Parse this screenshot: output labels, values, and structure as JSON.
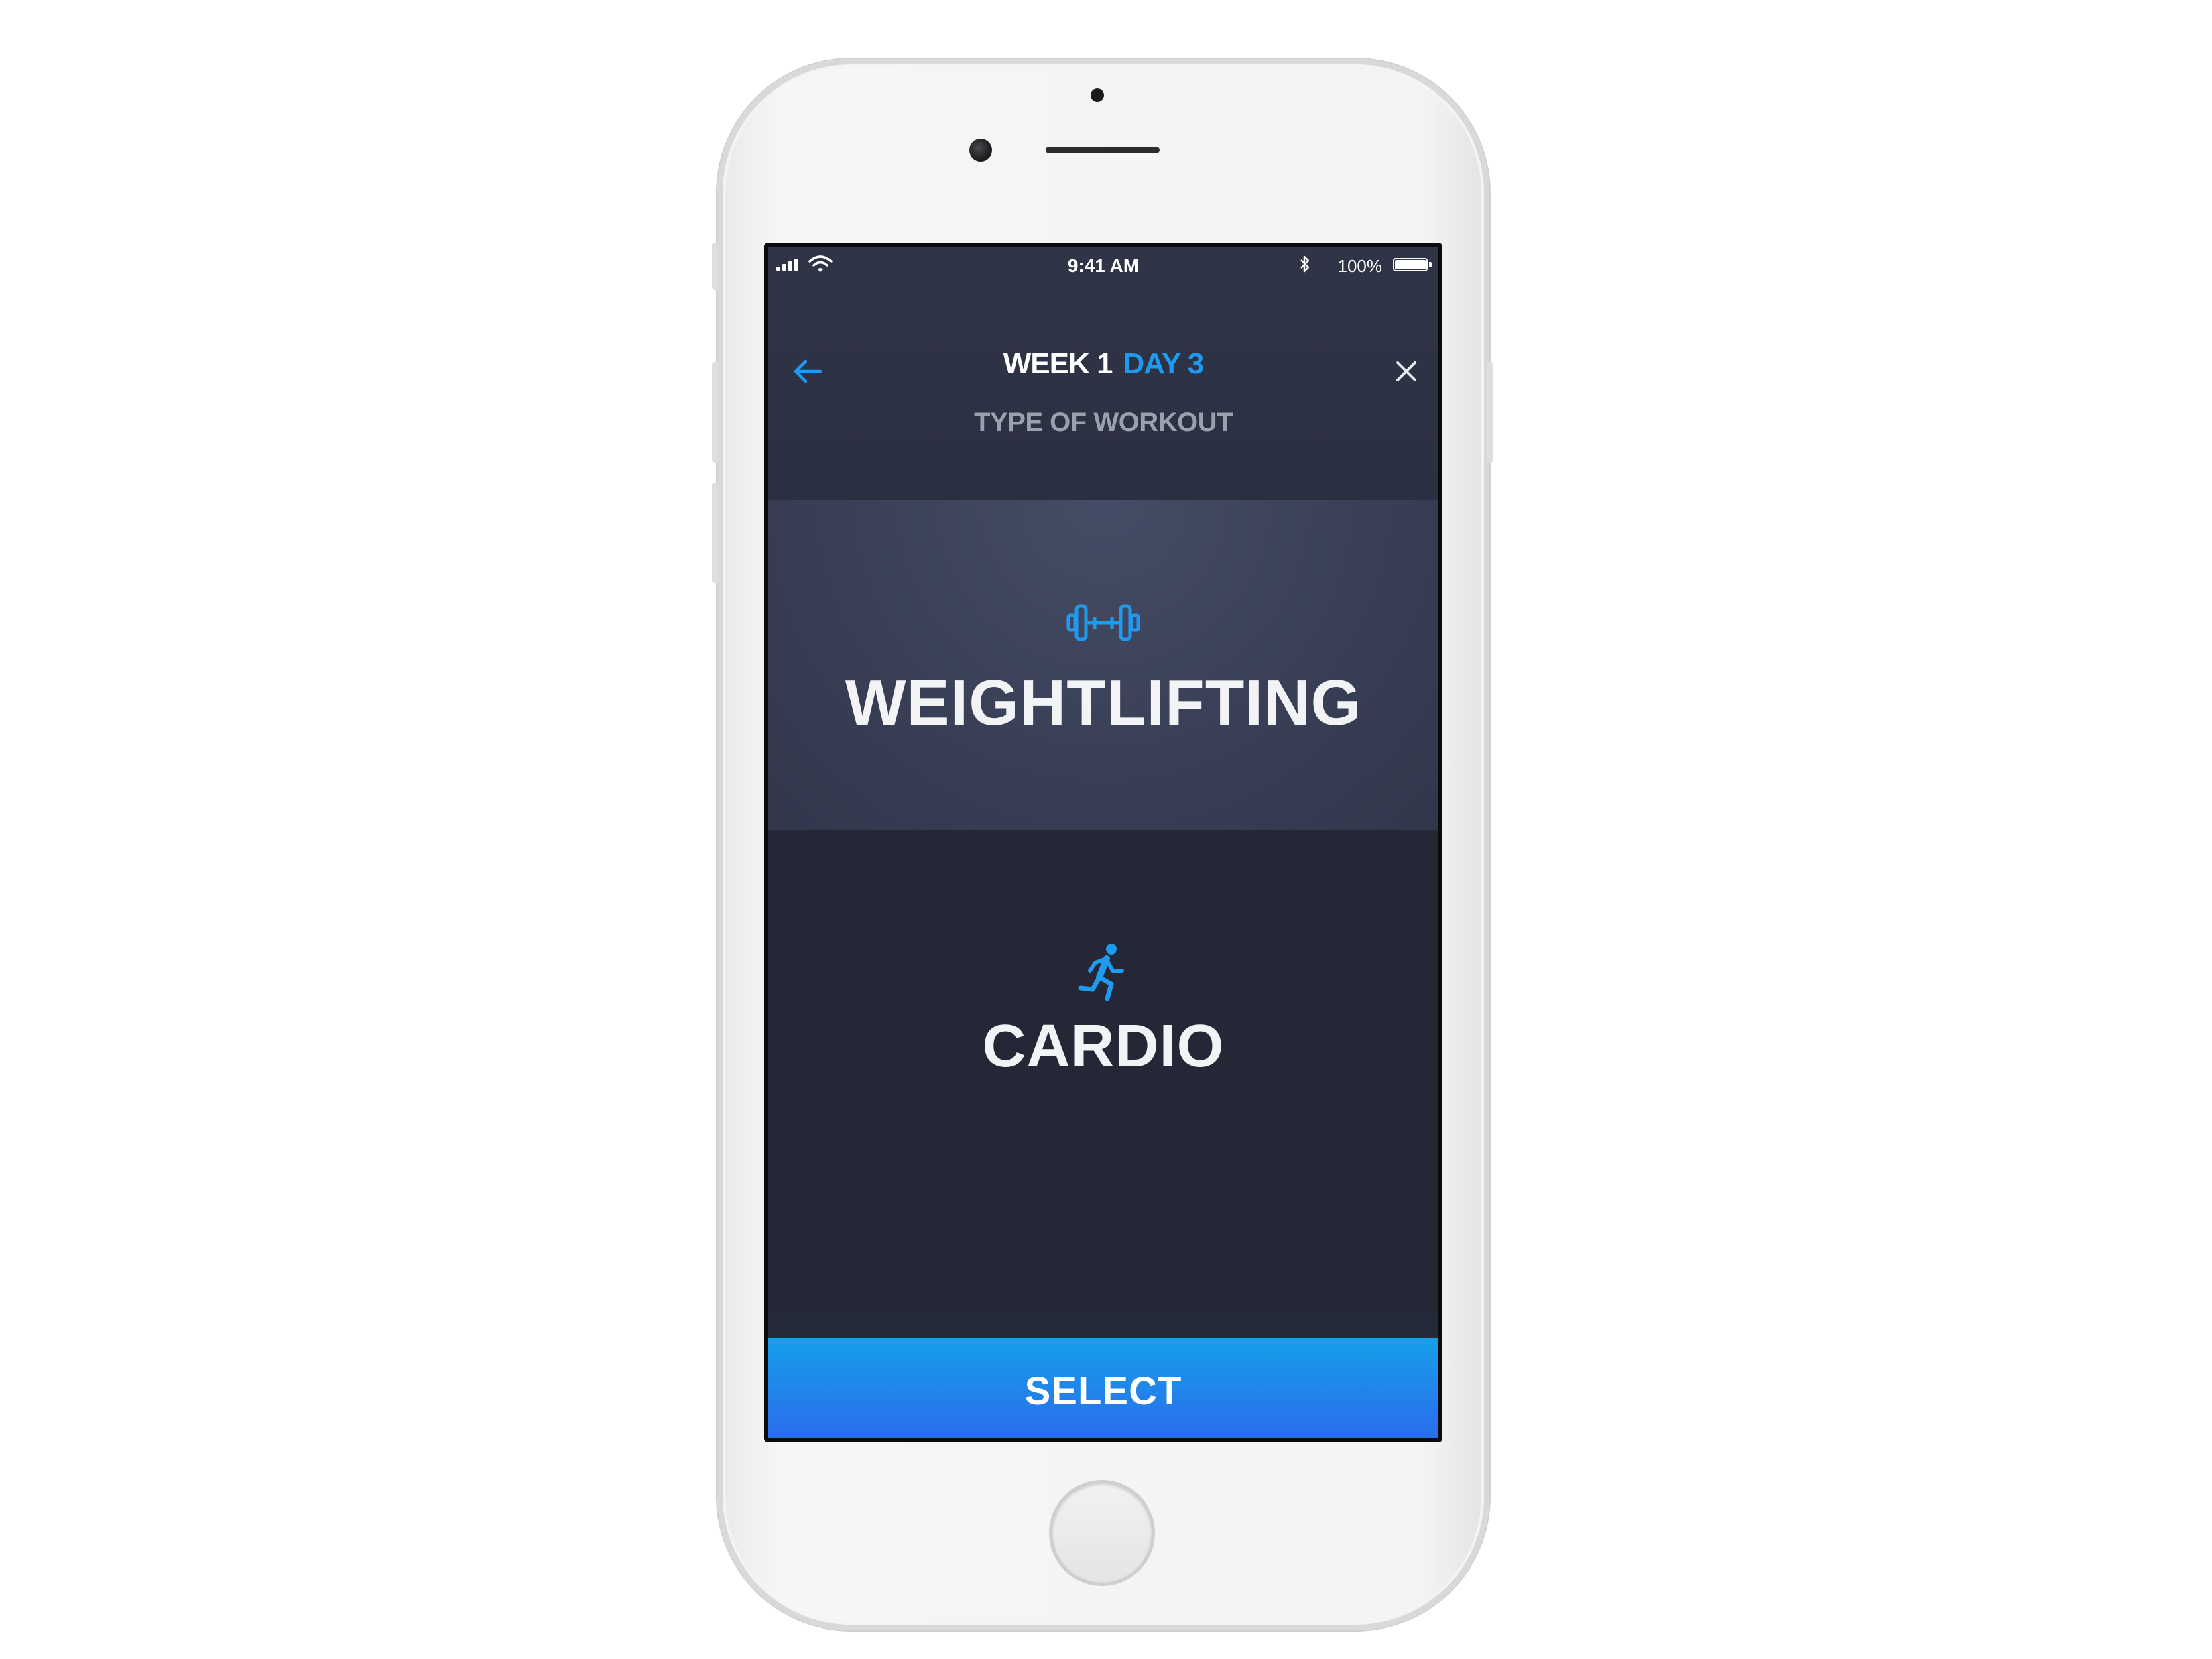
{
  "status_bar": {
    "time": "9:41 AM",
    "battery_percent": "100%",
    "signal_icon": "cellular-signal-icon",
    "wifi_icon": "wifi-icon",
    "bluetooth_icon": "bluetooth-icon",
    "battery_icon": "battery-icon"
  },
  "header": {
    "week": "WEEK 1",
    "day": "DAY 3",
    "subtitle": "TYPE OF WORKOUT",
    "back_icon": "arrow-left-icon",
    "close_icon": "close-icon"
  },
  "options": [
    {
      "label": "WEIGHTLIFTING",
      "icon": "dumbbell-icon",
      "selected": true
    },
    {
      "label": "CARDIO",
      "icon": "running-person-icon",
      "selected": false
    }
  ],
  "select_button": {
    "label": "SELECT"
  },
  "colors": {
    "accent": "#1e9af0",
    "background": "#252a3a",
    "selected_option": "#3b4259",
    "button_gradient_top": "#16a0ea",
    "button_gradient_bottom": "#2a6cec",
    "subtitle": "#9aa0ae"
  }
}
